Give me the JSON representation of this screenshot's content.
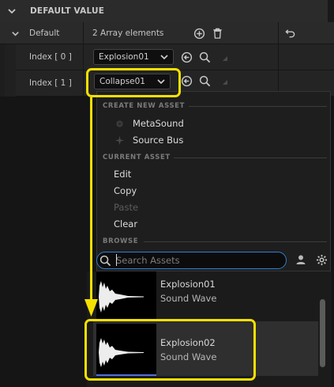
{
  "section": {
    "title": "DEFAULT VALUE"
  },
  "default_row": {
    "label": "Default",
    "summary": "2 Array elements"
  },
  "array_rows": [
    {
      "label": "Index [ 0 ]",
      "value": "Explosion01"
    },
    {
      "label": "Index [ 1 ]",
      "value": "Collapse01"
    }
  ],
  "dropdown": {
    "create_new_asset": {
      "heading": "CREATE NEW ASSET",
      "items": [
        {
          "label": "MetaSound",
          "icon": "metasound-icon"
        },
        {
          "label": "Source Bus",
          "icon": "source-bus-icon"
        }
      ]
    },
    "current_asset": {
      "heading": "CURRENT ASSET",
      "items": [
        {
          "label": "Edit",
          "enabled": true
        },
        {
          "label": "Copy",
          "enabled": true
        },
        {
          "label": "Paste",
          "enabled": false
        },
        {
          "label": "Clear",
          "enabled": true
        }
      ]
    },
    "browse": {
      "heading": "BROWSE",
      "search_placeholder": "Search Assets"
    },
    "assets": [
      {
        "name": "Explosion01",
        "type": "Sound Wave",
        "selected": false
      },
      {
        "name": "Explosion02",
        "type": "Sound Wave",
        "selected": true
      }
    ]
  },
  "colors": {
    "highlight": "#f5e000",
    "search_border": "#2f7fd0",
    "selection_underline": "#5470d8"
  }
}
